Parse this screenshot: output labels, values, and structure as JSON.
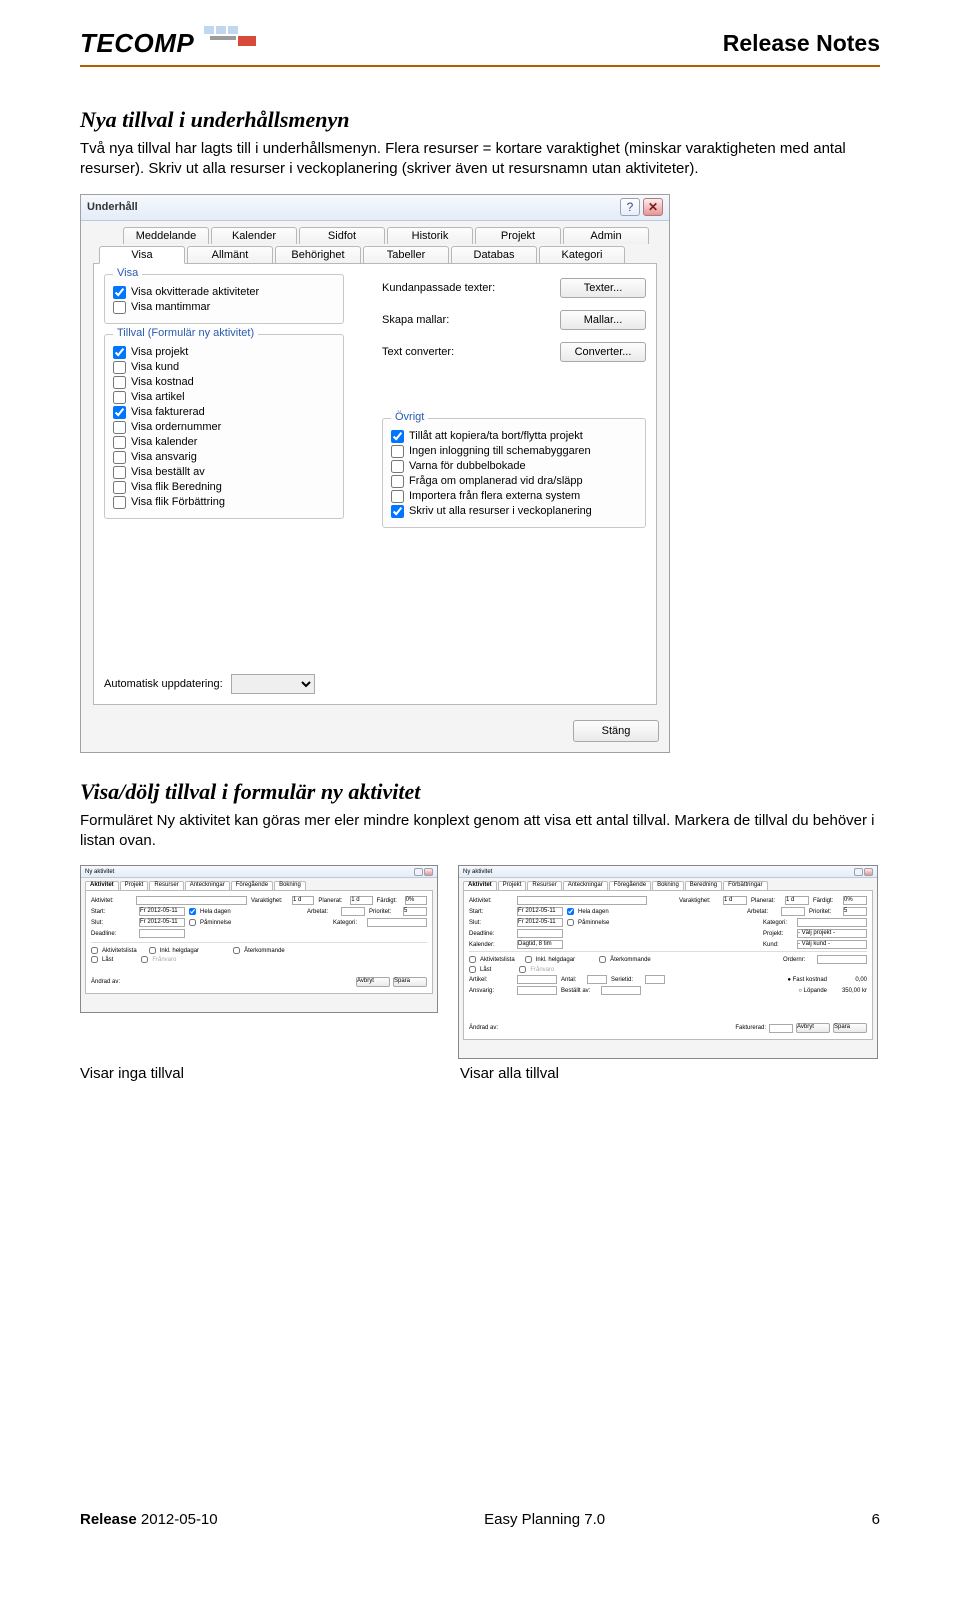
{
  "header": {
    "logo_text": "TECOMP",
    "title": "Release Notes"
  },
  "section1": {
    "heading": "Nya tillval i underhållsmenyn",
    "body": "Två nya tillval har lagts till i underhållsmenyn. Flera resurser = kortare varaktighet (minskar varaktigheten med antal resurser). Skriv ut alla resurser i veckoplanering (skriver även ut resursnamn utan aktiviteter)."
  },
  "dialog": {
    "title": "Underhåll",
    "tabs_row1": [
      "Meddelande",
      "Kalender",
      "Sidfot",
      "Historik",
      "Projekt",
      "Admin"
    ],
    "tabs_row2": [
      "Visa",
      "Allmänt",
      "Behörighet",
      "Tabeller",
      "Databas",
      "Kategori"
    ],
    "active_tab": "Visa",
    "fs_visa": {
      "legend": "Visa",
      "items": [
        {
          "label": "Visa okvitterade aktiviteter",
          "checked": true
        },
        {
          "label": "Visa mantimmar",
          "checked": false
        }
      ]
    },
    "fs_tillval": {
      "legend": "Tillval (Formulär ny aktivitet)",
      "items": [
        {
          "label": "Visa projekt",
          "checked": true
        },
        {
          "label": "Visa kund",
          "checked": false
        },
        {
          "label": "Visa kostnad",
          "checked": false
        },
        {
          "label": "Visa artikel",
          "checked": false
        },
        {
          "label": "Visa fakturerad",
          "checked": true
        },
        {
          "label": "Visa ordernummer",
          "checked": false
        },
        {
          "label": "Visa kalender",
          "checked": false
        },
        {
          "label": "Visa ansvarig",
          "checked": false
        },
        {
          "label": "Visa beställt av",
          "checked": false
        },
        {
          "label": "Visa flik Beredning",
          "checked": false
        },
        {
          "label": "Visa flik Förbättring",
          "checked": false
        }
      ]
    },
    "right": [
      {
        "label": "Kundanpassade texter:",
        "button": "Texter..."
      },
      {
        "label": "Skapa mallar:",
        "button": "Mallar..."
      },
      {
        "label": "Text converter:",
        "button": "Converter..."
      }
    ],
    "fs_ovrigt": {
      "legend": "Övrigt",
      "items": [
        {
          "label": "Tillåt att kopiera/ta bort/flytta projekt",
          "checked": true
        },
        {
          "label": "Ingen inloggning till schemabyggaren",
          "checked": false
        },
        {
          "label": "Varna för dubbelbokade",
          "checked": false
        },
        {
          "label": "Fråga om omplanerad vid dra/släpp",
          "checked": false
        },
        {
          "label": "Importera från flera externa system",
          "checked": false
        },
        {
          "label": "Skriv ut alla resurser i veckoplanering",
          "checked": true
        }
      ]
    },
    "auto_update_label": "Automatisk uppdatering:",
    "close_btn": "Stäng"
  },
  "section2": {
    "heading": "Visa/dölj tillval i formulär ny aktivitet",
    "body": "Formuläret Ny aktivitet kan göras mer eler mindre konplext genom att visa ett antal tillval. Markera de tillval du behöver i listan ovan."
  },
  "mini": {
    "title": "Ny aktivitet",
    "tabs_short": [
      "Aktivitet",
      "Projekt",
      "Resurser",
      "Anteckningar",
      "Föregående",
      "Bokning"
    ],
    "tabs_long": [
      "Aktivitet",
      "Projekt",
      "Resurser",
      "Anteckningar",
      "Föregående",
      "Bokning",
      "Beredning",
      "Förbättringar"
    ],
    "labels": {
      "aktivitet": "Aktivitet:",
      "start": "Start:",
      "slut": "Slut:",
      "deadline": "Deadline:",
      "kalender": "Kalender:",
      "varaktighet": "Varaktighet:",
      "planerat": "Planerat:",
      "fardigt": "Färdigt:",
      "arbetat": "Arbetat:",
      "prioritet": "Prioritet:",
      "kategori": "Kategori:",
      "projekt": "Projekt:",
      "kund": "Kund:",
      "ordernr": "Ordernr:",
      "artikel": "Artikel:",
      "antal": "Antal:",
      "serietid": "Serietid:",
      "ansvarig": "Ansvarig:",
      "bestallt": "Beställt av:",
      "fakturerad": "Fakturerad:",
      "hela_dagen": "Hela dagen",
      "paminnelse": "Påminnelse",
      "aterkommande": "Återkommande",
      "aktivitetslista": "Aktivitetslista",
      "inkl_helg": "Inkl. helgdagar",
      "last": "Låst",
      "franvaro": "Frånvaro",
      "andrad_av": "Ändrad av:",
      "fast_kostnad": "Fast kostnad",
      "lopande": "Löpande"
    },
    "values": {
      "date": "Fr 2012-05-11",
      "var_val": "1 d",
      "plan_val": "1 d",
      "fardigt_val": "0%",
      "prio_val": "5",
      "kal_val": "Dagtid, 8 tim",
      "proj_val": "- Välj projekt -",
      "kund_val": "- Välj kund -",
      "fast_cost": "0,00",
      "lop_cost": "350,00 kr"
    },
    "buttons": {
      "avbryt": "Avbryt",
      "spara": "Spara"
    }
  },
  "captions": {
    "a": "Visar inga tillval",
    "b": "Visar alla tillval"
  },
  "footer": {
    "release_label": "Release",
    "release_date": "2012-05-10",
    "center": "Easy Planning 7.0",
    "page": "6"
  }
}
